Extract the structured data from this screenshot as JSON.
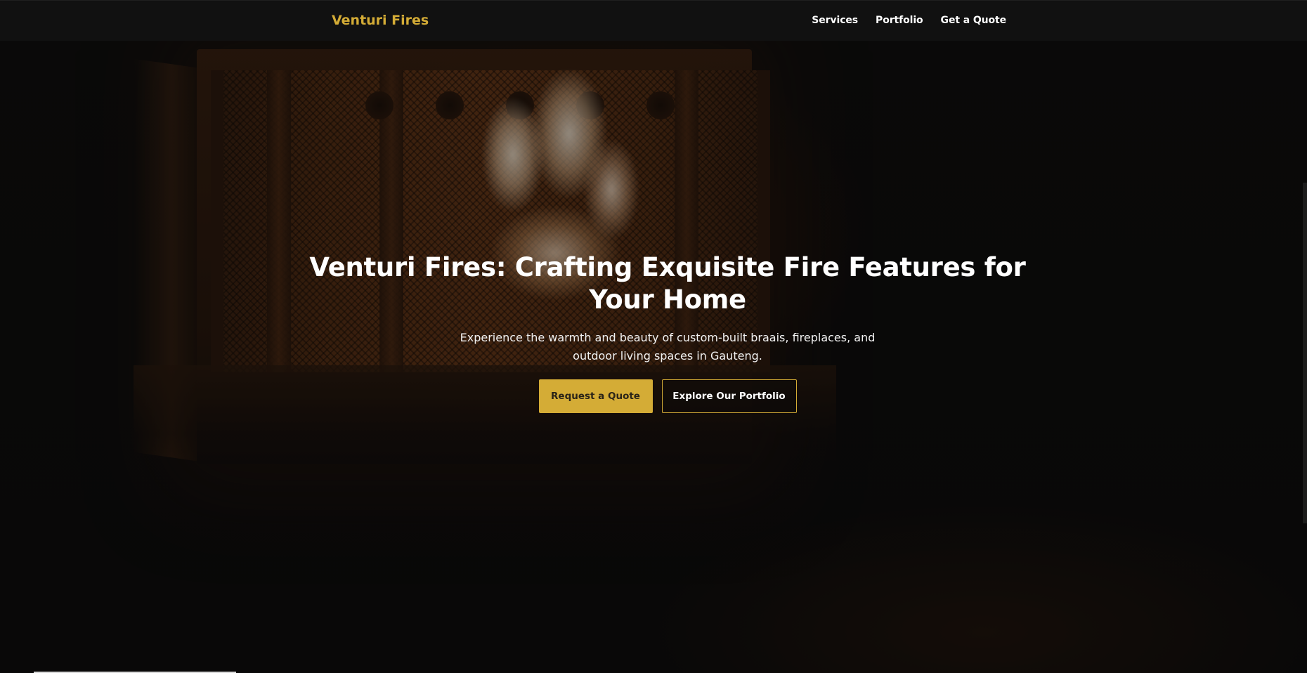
{
  "navbar": {
    "brand": "Venturi Fires",
    "links": [
      {
        "label": "Services"
      },
      {
        "label": "Portfolio"
      },
      {
        "label": "Get a Quote"
      }
    ]
  },
  "hero": {
    "title": "Venturi Fires: Crafting Exquisite Fire Features for Your Home",
    "subtitle": "Experience the warmth and beauty of custom-built braais, fireplaces, and outdoor living spaces in Gauteng.",
    "primary_button": "Request a Quote",
    "secondary_button": "Explore Our Portfolio"
  },
  "colors": {
    "accent": "#d4ac36",
    "navbar_bg": "#111111",
    "page_bg": "#0c0b0a",
    "text": "#ffffff"
  }
}
